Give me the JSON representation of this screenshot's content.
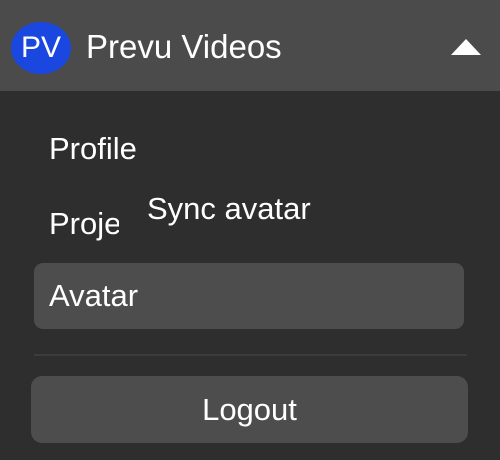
{
  "header": {
    "avatar_initials": "PV",
    "app_title": "Prevu Videos",
    "toggle_icon": "triangle-up-icon"
  },
  "menu": {
    "items": [
      {
        "label": "Profile"
      },
      {
        "label": "Projects"
      },
      {
        "label": "Avatar",
        "selected": true
      }
    ],
    "tooltip": "Sync avatar",
    "logout_label": "Logout"
  },
  "colors": {
    "header_bg": "#4b4b4b",
    "panel_bg": "#2e2e2e",
    "avatar_bg": "#1947e0",
    "item_bg": "#4d4d4d",
    "text": "#ffffff"
  }
}
